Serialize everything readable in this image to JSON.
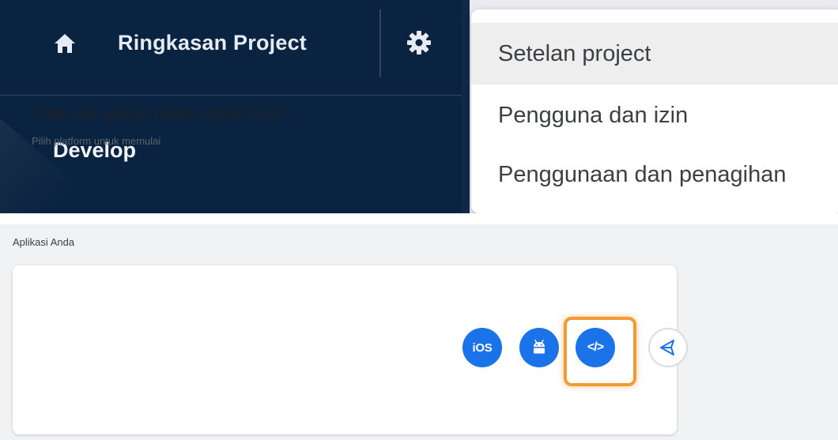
{
  "sidebar": {
    "project_title": "Ringkasan Project",
    "section_label": "Develop",
    "home_icon": "home-icon",
    "gear_icon": "gear-icon"
  },
  "settings_menu": {
    "items": [
      {
        "label": "Setelan project",
        "active": true
      },
      {
        "label": "Pengguna dan izin",
        "active": false
      },
      {
        "label": "Penggunaan dan penagihan",
        "active": false
      }
    ]
  },
  "apps": {
    "section_label": "Aplikasi Anda",
    "empty_title": "Tidak ada aplikasi dalam project Anda",
    "empty_subtitle": "Pilih platform untuk memulai",
    "platforms": [
      {
        "name": "ios",
        "label": "iOS"
      },
      {
        "name": "android",
        "label": ""
      },
      {
        "name": "web",
        "label": "</>"
      },
      {
        "name": "unity",
        "label": ""
      }
    ]
  },
  "colors": {
    "sidebar_bg": "#0a2340",
    "platform_button_blue": "#1a73e8",
    "highlight_orange": "#f39a34"
  }
}
